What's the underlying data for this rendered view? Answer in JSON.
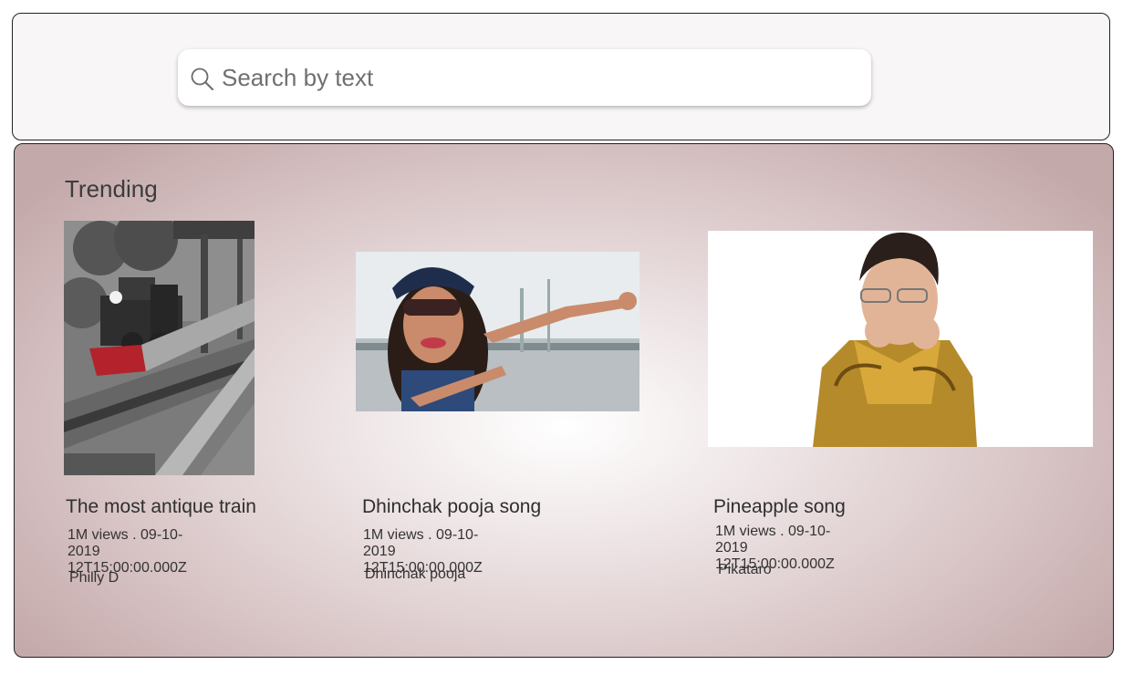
{
  "search": {
    "placeholder": "Search by text",
    "icon": "search-icon"
  },
  "trending": {
    "title": "Trending",
    "videos": [
      {
        "title": "The most antique train",
        "meta_line1": "1M views . 09-10-2019",
        "meta_line2": "12T15:00:00.000Z",
        "channel": "Philly D",
        "thumbnail_alt": "Vintage steam locomotive at a station"
      },
      {
        "title": "Dhinchak pooja song",
        "meta_line1": "1M views . 09-10-2019",
        "meta_line2": "12T15:00:00.000Z",
        "channel": "Dhinchak pooja",
        "thumbnail_alt": "Woman in cap and sunglasses posing"
      },
      {
        "title": "Pineapple song",
        "meta_line1": "1M views . 09-10-2019",
        "meta_line2": "12T15:00:00.000Z",
        "channel": "Pikataro",
        "thumbnail_alt": "Man in leopard print outfit posing"
      }
    ]
  },
  "colors": {
    "header_bg": "#f8f6f7",
    "panel_edge": "#c4a9aa",
    "panel_center": "#ffffff"
  }
}
